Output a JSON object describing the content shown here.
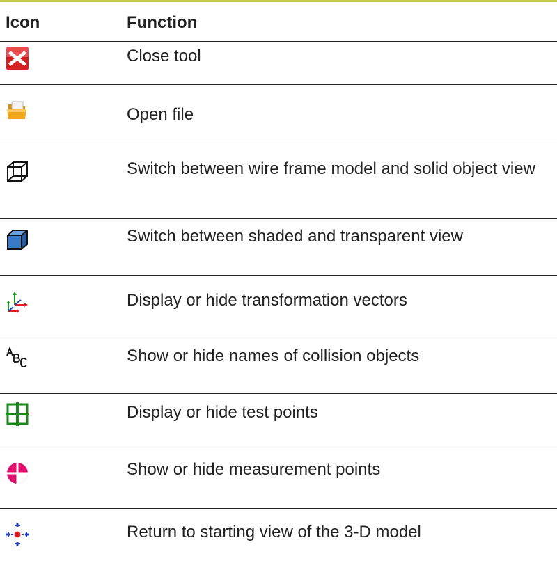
{
  "table": {
    "headers": {
      "icon": "Icon",
      "function": "Function"
    },
    "rows": [
      {
        "icon": "close-x-icon",
        "function": "Close tool"
      },
      {
        "icon": "open-folder-icon",
        "function": "Open file"
      },
      {
        "icon": "wireframe-cube-icon",
        "function": "Switch between wire frame model and solid object view"
      },
      {
        "icon": "shaded-cube-icon",
        "function": "Switch between shaded and transparent view"
      },
      {
        "icon": "transformation-vectors-icon",
        "function": "Display or hide transformation vectors"
      },
      {
        "icon": "abc-names-icon",
        "function": "Show or hide names of collision objects"
      },
      {
        "icon": "test-points-grid-icon",
        "function": "Display or hide test points"
      },
      {
        "icon": "measurement-point-icon",
        "function": "Show or hide measurement points"
      },
      {
        "icon": "starting-view-icon",
        "function": "Return to starting view of the 3-D model"
      }
    ]
  },
  "colors": {
    "top_rule": "#c7c948",
    "text": "#222222",
    "close_red": "#d42020",
    "folder_orange": "#f0a818",
    "cube_blue": "#3a78c8",
    "test_points_green": "#1a8a1a",
    "measurement_magenta": "#e0106e",
    "vector_green": "#1a9a1a",
    "vector_red": "#e02020",
    "vector_blue": "#2040c0"
  }
}
